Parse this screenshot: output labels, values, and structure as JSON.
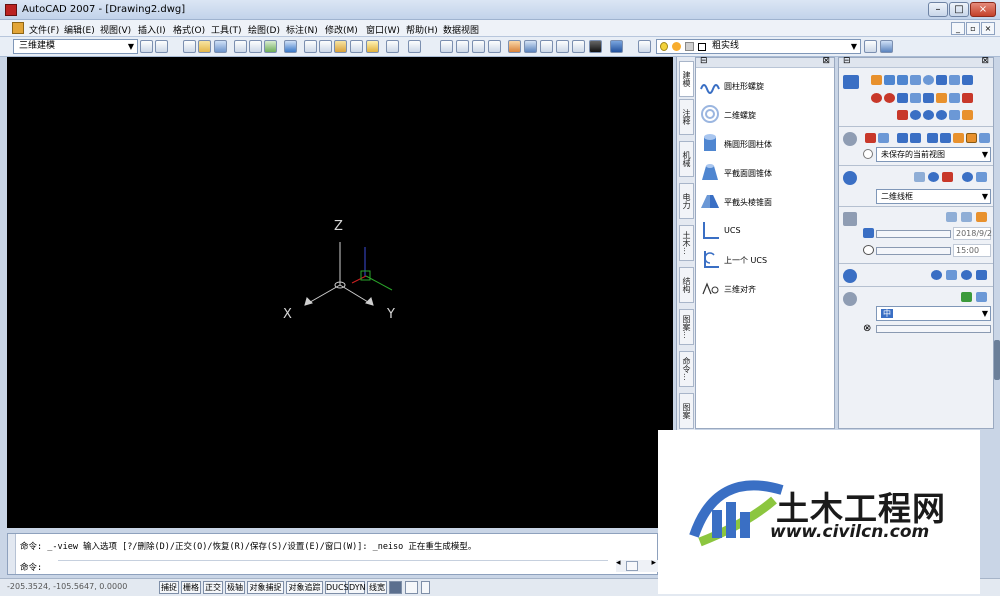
{
  "window": {
    "title": "AutoCAD 2007 - [Drawing2.dwg]",
    "minimize": "–",
    "maximize": "□",
    "close": "×"
  },
  "menu": {
    "items": [
      "文件(F)",
      "编辑(E)",
      "视图(V)",
      "插入(I)",
      "格式(O)",
      "工具(T)",
      "绘图(D)",
      "标注(N)",
      "修改(M)",
      "窗口(W)",
      "帮助(H)",
      "数据视图"
    ],
    "doc_minimize": "_",
    "doc_restore": "▫",
    "doc_close": "×"
  },
  "toolbar": {
    "workspace": "三维建模",
    "layer": "粗实线"
  },
  "canvas": {
    "axis_z": "Z",
    "axis_x": "X",
    "axis_y": "Y"
  },
  "tool_palette": {
    "tabs": [
      "建模",
      "注释",
      "机械",
      "电力",
      "土木...",
      "结构",
      "图案...",
      "命令...",
      "图案"
    ],
    "items": [
      {
        "label": "圆柱形螺旋",
        "icon": "helix-icon"
      },
      {
        "label": "二维螺旋",
        "icon": "spiral-icon"
      },
      {
        "label": "椭圆形圆柱体",
        "icon": "elliptical-cylinder-icon"
      },
      {
        "label": "平截面圆锥体",
        "icon": "frustum-cone-icon"
      },
      {
        "label": "平截头棱锥面",
        "icon": "frustum-pyramid-icon"
      },
      {
        "label": "UCS",
        "icon": "ucs-icon"
      },
      {
        "label": "上一个 UCS",
        "icon": "ucs-previous-icon"
      },
      {
        "label": "三维对齐",
        "icon": "3d-align-icon"
      }
    ]
  },
  "dashboard": {
    "view_select": "未保存的当前视图",
    "visual_style": "二维线框",
    "date_value": "2018/9/2",
    "time_value": "15:00",
    "material_select": "中",
    "colors": {
      "accent_blue": "#3a6fc4",
      "accent_orange": "#e8912d",
      "accent_red": "#c8382a",
      "accent_green": "#3b9a3b"
    }
  },
  "command": {
    "history": "命令: _-view 输入选项 [?/删除(D)/正交(O)/恢复(R)/保存(S)/设置(E)/窗口(W)]: _neiso 正在重生成模型。",
    "prompt": "命令:"
  },
  "statusbar": {
    "coords": "-205.3524, -105.5647, 0.0000",
    "buttons": [
      "捕捉",
      "栅格",
      "正交",
      "极轴",
      "对象捕捉",
      "对象追踪",
      "DUCS",
      "DYN",
      "线宽"
    ]
  },
  "watermark": {
    "name_cn": "土木工程网",
    "url": "www.civilcn.com"
  }
}
